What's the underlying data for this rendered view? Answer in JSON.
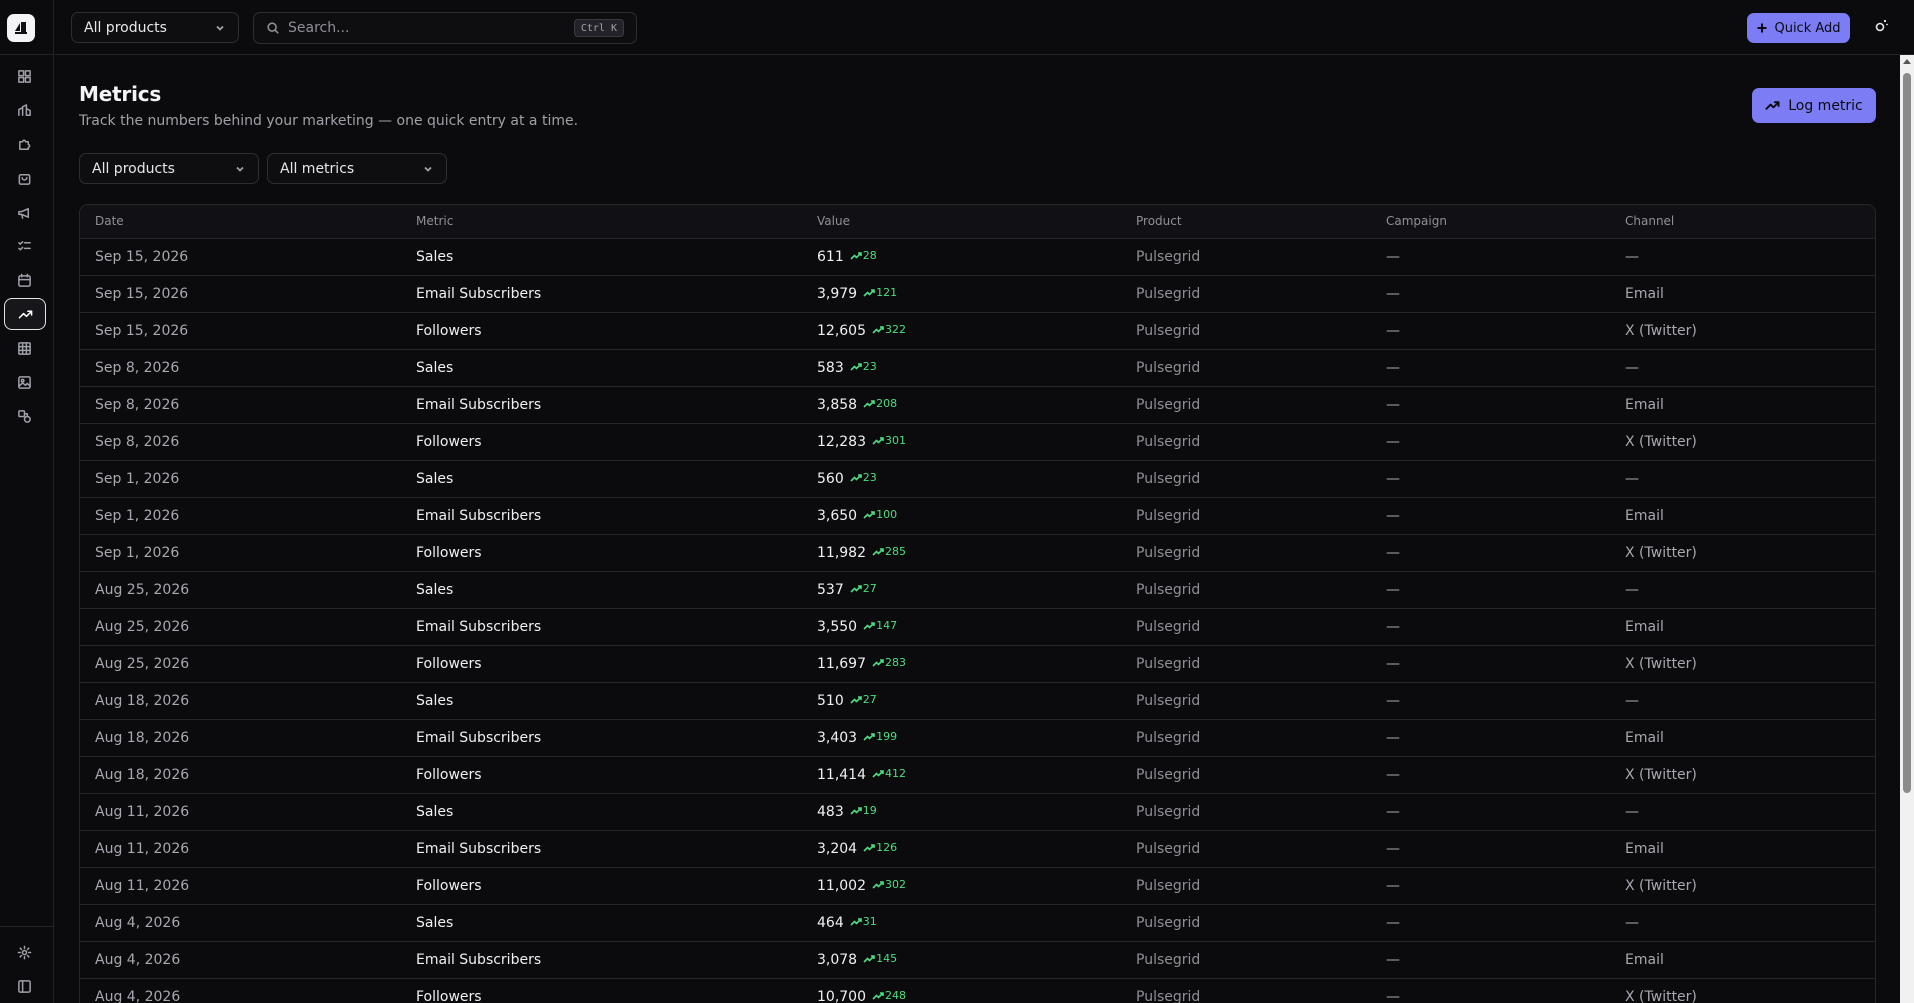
{
  "topbar": {
    "product_select": "All products",
    "search_placeholder": "Search...",
    "search_shortcut": "Ctrl K",
    "quick_add_label": "Quick Add"
  },
  "header": {
    "title": "Metrics",
    "subtitle": "Track the numbers behind your marketing — one quick entry at a time.",
    "log_metric_label": "Log metric"
  },
  "filters": {
    "product": "All products",
    "metric": "All metrics"
  },
  "table": {
    "columns": [
      "Date",
      "Metric",
      "Value",
      "Product",
      "Campaign",
      "Channel"
    ],
    "rows": [
      {
        "date": "Sep 15, 2026",
        "metric": "Sales",
        "value": "611",
        "delta": "28",
        "product": "Pulsegrid",
        "campaign": "—",
        "channel": "—"
      },
      {
        "date": "Sep 15, 2026",
        "metric": "Email Subscribers",
        "value": "3,979",
        "delta": "121",
        "product": "Pulsegrid",
        "campaign": "—",
        "channel": "Email"
      },
      {
        "date": "Sep 15, 2026",
        "metric": "Followers",
        "value": "12,605",
        "delta": "322",
        "product": "Pulsegrid",
        "campaign": "—",
        "channel": "X (Twitter)"
      },
      {
        "date": "Sep 8, 2026",
        "metric": "Sales",
        "value": "583",
        "delta": "23",
        "product": "Pulsegrid",
        "campaign": "—",
        "channel": "—"
      },
      {
        "date": "Sep 8, 2026",
        "metric": "Email Subscribers",
        "value": "3,858",
        "delta": "208",
        "product": "Pulsegrid",
        "campaign": "—",
        "channel": "Email"
      },
      {
        "date": "Sep 8, 2026",
        "metric": "Followers",
        "value": "12,283",
        "delta": "301",
        "product": "Pulsegrid",
        "campaign": "—",
        "channel": "X (Twitter)"
      },
      {
        "date": "Sep 1, 2026",
        "metric": "Sales",
        "value": "560",
        "delta": "23",
        "product": "Pulsegrid",
        "campaign": "—",
        "channel": "—"
      },
      {
        "date": "Sep 1, 2026",
        "metric": "Email Subscribers",
        "value": "3,650",
        "delta": "100",
        "product": "Pulsegrid",
        "campaign": "—",
        "channel": "Email"
      },
      {
        "date": "Sep 1, 2026",
        "metric": "Followers",
        "value": "11,982",
        "delta": "285",
        "product": "Pulsegrid",
        "campaign": "—",
        "channel": "X (Twitter)"
      },
      {
        "date": "Aug 25, 2026",
        "metric": "Sales",
        "value": "537",
        "delta": "27",
        "product": "Pulsegrid",
        "campaign": "—",
        "channel": "—"
      },
      {
        "date": "Aug 25, 2026",
        "metric": "Email Subscribers",
        "value": "3,550",
        "delta": "147",
        "product": "Pulsegrid",
        "campaign": "—",
        "channel": "Email"
      },
      {
        "date": "Aug 25, 2026",
        "metric": "Followers",
        "value": "11,697",
        "delta": "283",
        "product": "Pulsegrid",
        "campaign": "—",
        "channel": "X (Twitter)"
      },
      {
        "date": "Aug 18, 2026",
        "metric": "Sales",
        "value": "510",
        "delta": "27",
        "product": "Pulsegrid",
        "campaign": "—",
        "channel": "—"
      },
      {
        "date": "Aug 18, 2026",
        "metric": "Email Subscribers",
        "value": "3,403",
        "delta": "199",
        "product": "Pulsegrid",
        "campaign": "—",
        "channel": "Email"
      },
      {
        "date": "Aug 18, 2026",
        "metric": "Followers",
        "value": "11,414",
        "delta": "412",
        "product": "Pulsegrid",
        "campaign": "—",
        "channel": "X (Twitter)"
      },
      {
        "date": "Aug 11, 2026",
        "metric": "Sales",
        "value": "483",
        "delta": "19",
        "product": "Pulsegrid",
        "campaign": "—",
        "channel": "—"
      },
      {
        "date": "Aug 11, 2026",
        "metric": "Email Subscribers",
        "value": "3,204",
        "delta": "126",
        "product": "Pulsegrid",
        "campaign": "—",
        "channel": "Email"
      },
      {
        "date": "Aug 11, 2026",
        "metric": "Followers",
        "value": "11,002",
        "delta": "302",
        "product": "Pulsegrid",
        "campaign": "—",
        "channel": "X (Twitter)"
      },
      {
        "date": "Aug 4, 2026",
        "metric": "Sales",
        "value": "464",
        "delta": "31",
        "product": "Pulsegrid",
        "campaign": "—",
        "channel": "—"
      },
      {
        "date": "Aug 4, 2026",
        "metric": "Email Subscribers",
        "value": "3,078",
        "delta": "145",
        "product": "Pulsegrid",
        "campaign": "—",
        "channel": "Email"
      },
      {
        "date": "Aug 4, 2026",
        "metric": "Followers",
        "value": "10,700",
        "delta": "248",
        "product": "Pulsegrid",
        "campaign": "—",
        "channel": "X (Twitter)"
      }
    ]
  },
  "sidebar": {
    "items": [
      {
        "icon": "dashboard-icon"
      },
      {
        "icon": "products-icon"
      },
      {
        "icon": "puzzle-icon"
      },
      {
        "icon": "bag-icon"
      },
      {
        "icon": "megaphone-icon"
      },
      {
        "icon": "checklist-icon"
      },
      {
        "icon": "calendar-icon"
      },
      {
        "icon": "trending-up-icon",
        "active": true
      },
      {
        "icon": "table-icon"
      },
      {
        "icon": "image-icon"
      },
      {
        "icon": "shapes-icon"
      }
    ],
    "bottom": [
      {
        "icon": "gear-icon"
      },
      {
        "icon": "collapse-sidebar-icon"
      }
    ]
  },
  "colors": {
    "accent": "#7c7cf5",
    "positive": "#4ade80",
    "background": "#0b0b0e"
  }
}
